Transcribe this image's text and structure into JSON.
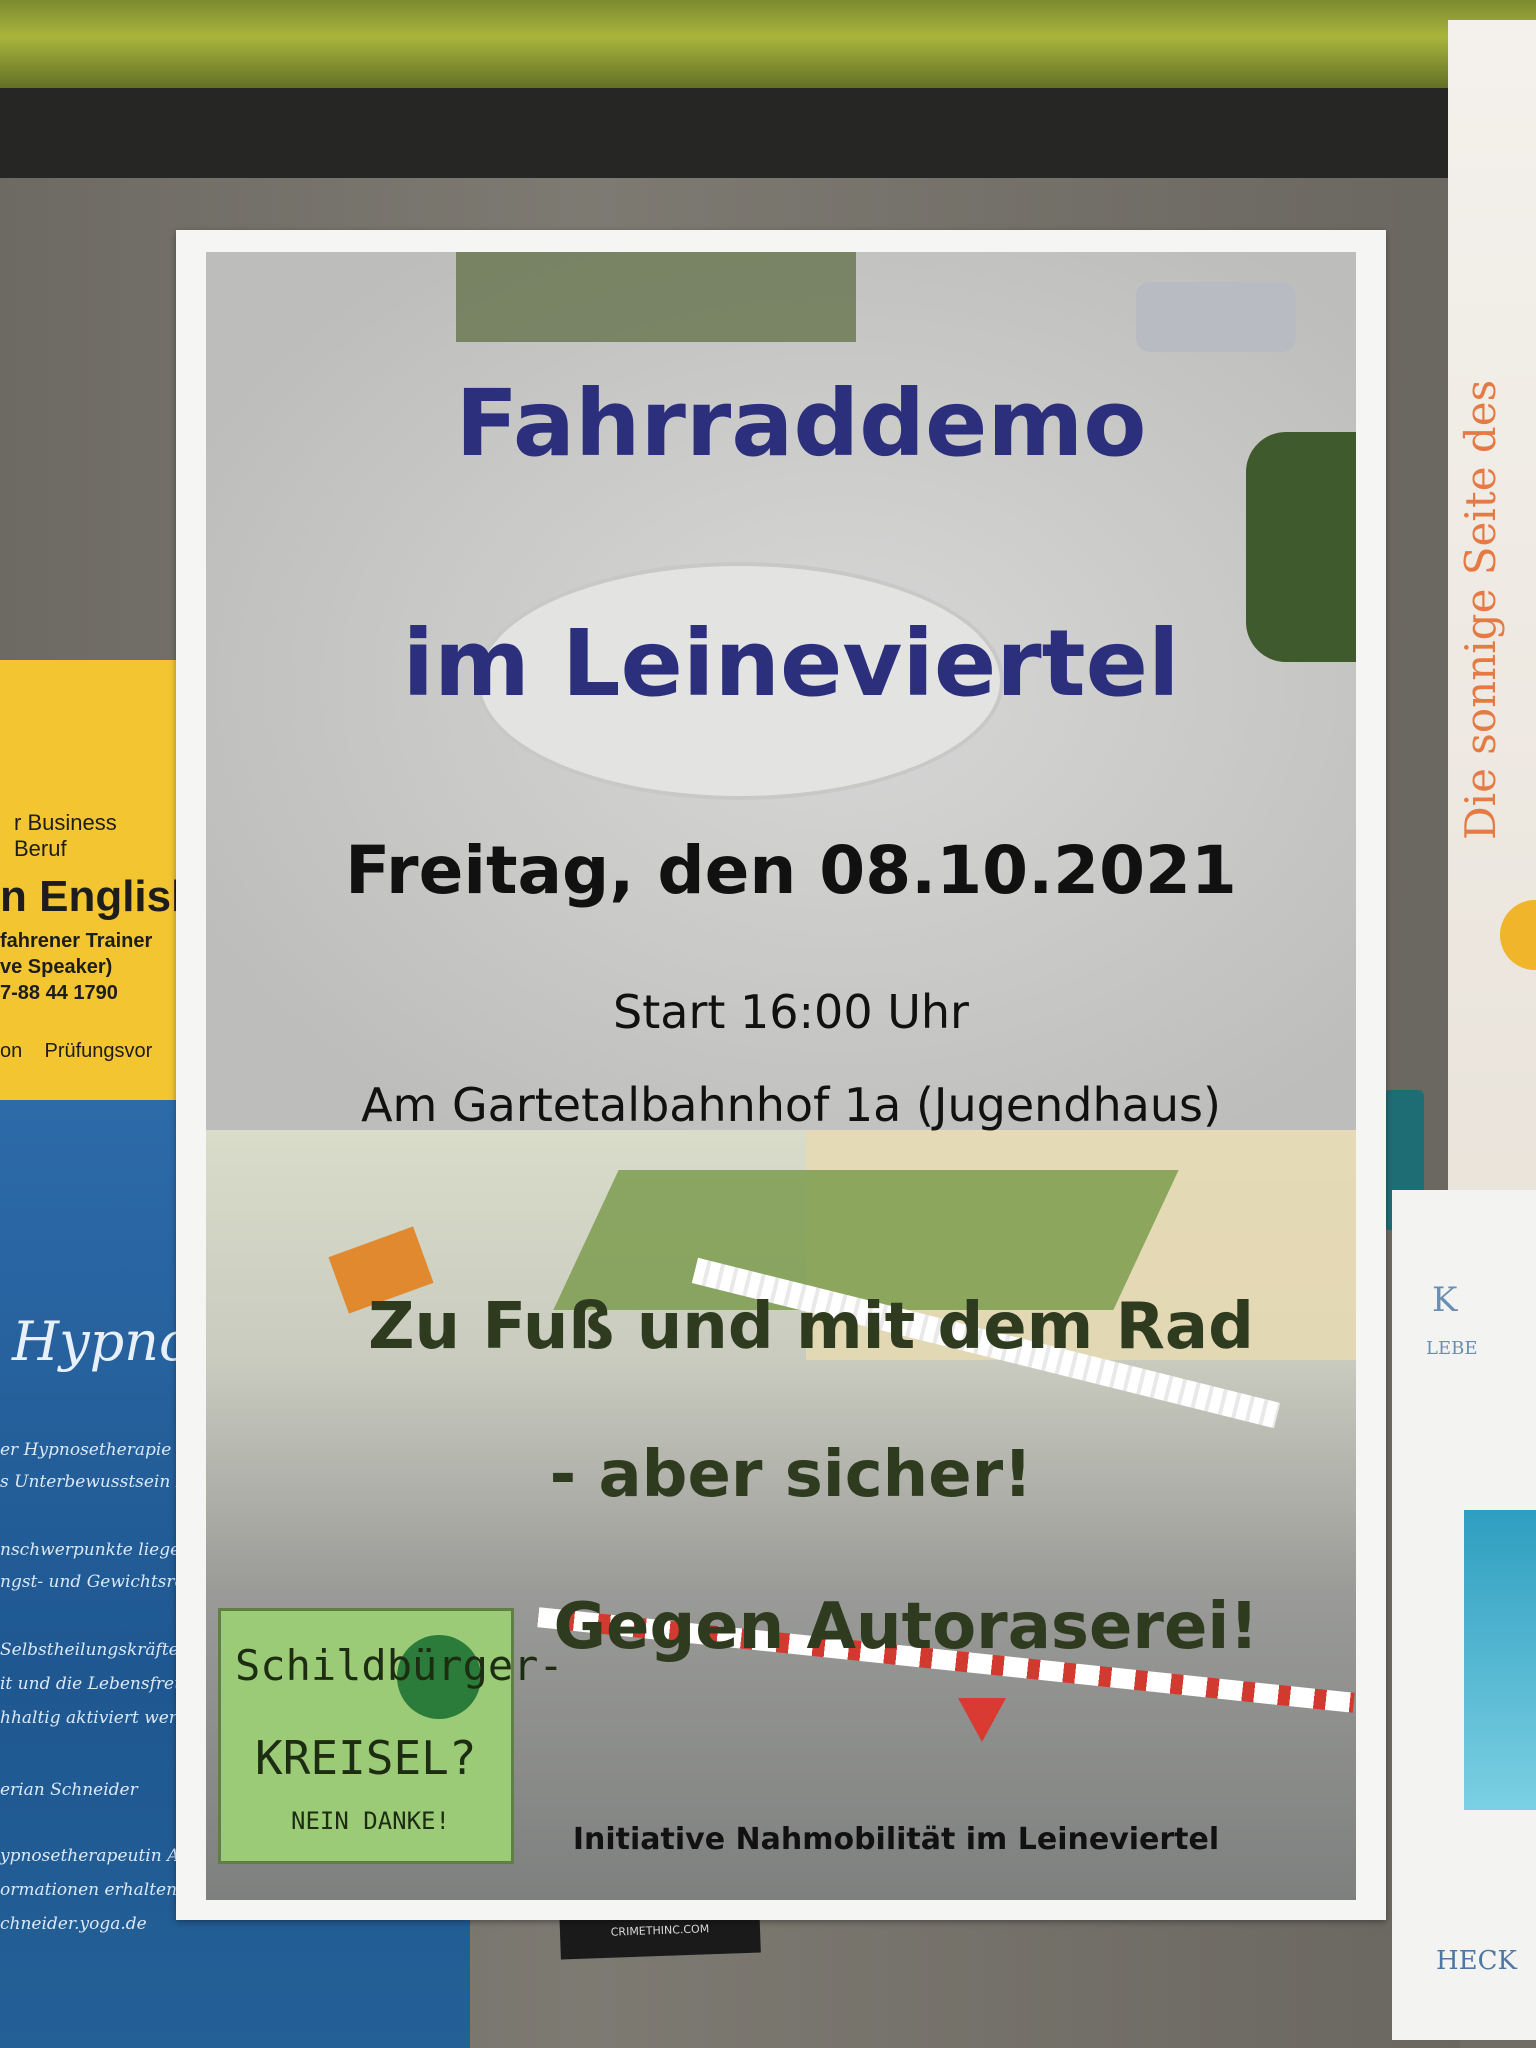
{
  "poster": {
    "headline_line1": "Fahrraddemo",
    "headline_line2": "im Leineviertel",
    "date": "Freitag, den 08.10.2021",
    "start_time": "Start 16:00 Uhr",
    "location": "Am Gartetalbahnhof 1a (Jugendhaus)",
    "slogan_line1": "Zu Fuß und mit dem Rad",
    "slogan_line2": "- aber sicher!",
    "slogan_line3": "Gegen Autoraserei!",
    "organizer": "Initiative Nahmobilität im Leineviertel",
    "sign": {
      "word1": "Schildbürger-",
      "word2": "KREISEL?",
      "word3": "NEIN DANKE!"
    },
    "colors": {
      "headline": "#2b2f7c",
      "slogan": "#2e3b1f",
      "body": "#111111"
    }
  },
  "side_flyers": {
    "yellow": {
      "line1": "r Business",
      "line2": "Beruf",
      "line3": "n English!",
      "line4": "fahrener Trainer",
      "line5": "ve Speaker)",
      "line6": "7-88 44 1790",
      "line7": "Prüfungsvor",
      "line7_prefix": "on"
    },
    "blue": {
      "title": "Hypno",
      "lines": [
        "er Hypnosetherapie k",
        "s Unterbewusstsein zu",
        "nschwerpunkte liegen",
        "ngst- und Gewichtsredu",
        "Selbstheilungskräfte,",
        "it und die Lebensfreu",
        "hhaltig aktiviert werd",
        "erian Schneider",
        "ypnosetherapeutin AMN",
        "ormationen erhalten Sie hier:",
        "chneider.yoga.de"
      ]
    },
    "right_top": {
      "vertical_text": "Die sonnige Seite des"
    },
    "right_bottom": {
      "k": "K",
      "lebe": "LEBE",
      "heck": "HECK"
    },
    "sticker": "CRIMETHINC.COM"
  }
}
